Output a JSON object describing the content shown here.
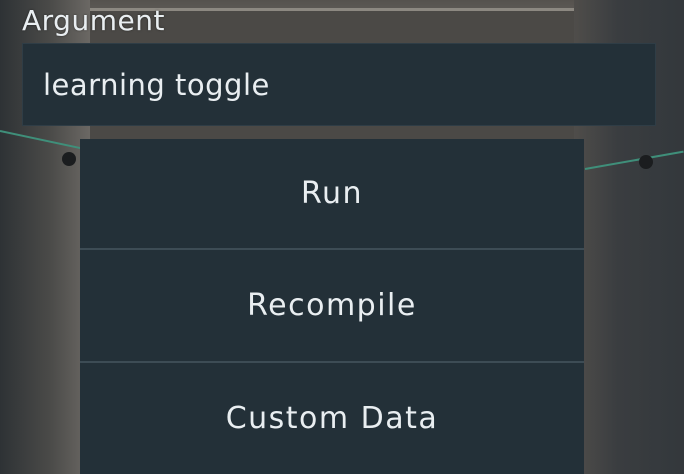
{
  "argument": {
    "label": "Argument",
    "value": "learning toggle"
  },
  "menu": {
    "items": [
      {
        "label": "Run"
      },
      {
        "label": "Recompile"
      },
      {
        "label": "Custom Data"
      }
    ]
  }
}
